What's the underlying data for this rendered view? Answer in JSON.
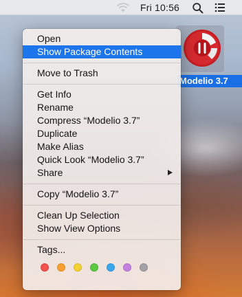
{
  "menubar": {
    "clock": "Fri 10:56",
    "icons": [
      "wifi-icon",
      "spotlight-search-icon",
      "notification-center-icon"
    ]
  },
  "desktop_item": {
    "label": "Modelio 3.7",
    "icon": "modelio-app-icon",
    "icon_colors": {
      "ring": "#d42a2f",
      "face": "#ffffff"
    }
  },
  "context_menu": {
    "groups": [
      [
        {
          "label": "Open"
        },
        {
          "label": "Show Package Contents",
          "highlighted": true
        }
      ],
      [
        {
          "label": "Move to Trash"
        }
      ],
      [
        {
          "label": "Get Info"
        },
        {
          "label": "Rename"
        },
        {
          "label": "Compress “Modelio 3.7”"
        },
        {
          "label": "Duplicate"
        },
        {
          "label": "Make Alias"
        },
        {
          "label": "Quick Look “Modelio 3.7”"
        },
        {
          "label": "Share",
          "submenu": true
        }
      ],
      [
        {
          "label": "Copy “Modelio 3.7”"
        }
      ],
      [
        {
          "label": "Clean Up Selection"
        },
        {
          "label": "Show View Options"
        }
      ],
      [
        {
          "label": "Tags..."
        }
      ]
    ],
    "tags": [
      {
        "name": "red",
        "color": "#f2514d"
      },
      {
        "name": "orange",
        "color": "#f7a030"
      },
      {
        "name": "yellow",
        "color": "#f5d234"
      },
      {
        "name": "green",
        "color": "#5cc942"
      },
      {
        "name": "blue",
        "color": "#3aa8ee"
      },
      {
        "name": "purple",
        "color": "#c481e0"
      },
      {
        "name": "gray",
        "color": "#a2a2a6"
      }
    ],
    "highlight_color": "#1c75ea"
  }
}
